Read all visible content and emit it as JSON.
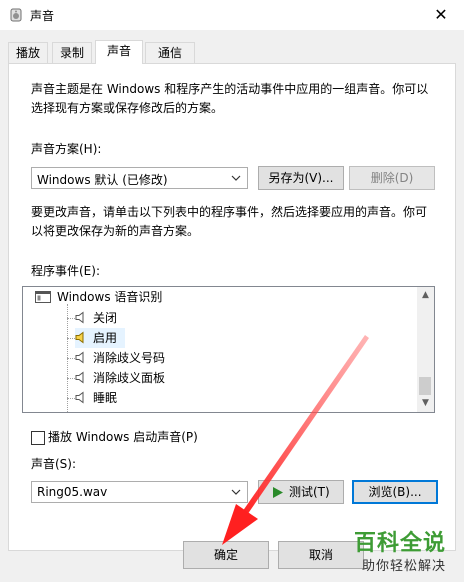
{
  "window": {
    "title": "声音",
    "close_glyph": "✕"
  },
  "tabs": [
    {
      "label": "播放"
    },
    {
      "label": "录制"
    },
    {
      "label": "声音"
    },
    {
      "label": "通信"
    }
  ],
  "active_tab": "声音",
  "sounds": {
    "intro_text_line1": "声音主题是在 Windows 和程序产生的活动事件中应用的一组声音。你可以",
    "intro_text_line2": "选择现有方案或保存修改后的方案。",
    "scheme_label": "声音方案(H):",
    "scheme_value": "Windows 默认 (已修改)",
    "save_as_label": "另存为(V)...",
    "delete_label": "删除(D)",
    "instructions_line1": "要更改声音，请单击以下列表中的程序事件，然后选择要应用的声音。你可",
    "instructions_line2": "以将更改保存为新的声音方案。",
    "events_label": "程序事件(E):",
    "events": {
      "group": "Windows 语音识别",
      "items": [
        {
          "label": "关闭",
          "selected": false
        },
        {
          "label": "启用",
          "selected": true
        },
        {
          "label": "消除歧义号码",
          "selected": false
        },
        {
          "label": "消除歧义面板",
          "selected": false
        },
        {
          "label": "睡眠",
          "selected": false
        }
      ]
    },
    "startup_checkbox_label": "播放 Windows 启动声音(P)",
    "startup_checked": false,
    "sound_label": "声音(S):",
    "sound_value": "Ring05.wav",
    "test_label": "测试(T)",
    "browse_label": "浏览(B)..."
  },
  "footer": {
    "ok_label": "确定",
    "cancel_label": "取消"
  },
  "watermark": {
    "title": "百科全说",
    "subtitle": "助你轻松解决"
  },
  "colors": {
    "accent": "#0078d7",
    "annotation_arrow": "#ff3b3b",
    "watermark_green": "#3e9c35"
  }
}
